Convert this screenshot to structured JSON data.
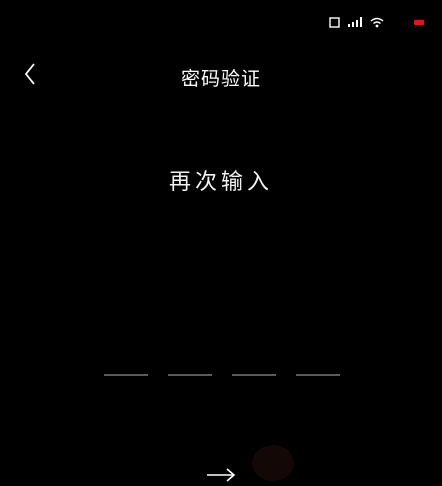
{
  "status_bar": {
    "icons": [
      "sim-icon",
      "signal-icon",
      "wifi-icon",
      "battery-icon"
    ],
    "battery_color": "#e0141e"
  },
  "header": {
    "back_icon": "chevron-left-icon",
    "title": "密码验证"
  },
  "main": {
    "prompt": "再次输入",
    "hint": "",
    "code_slots": 4,
    "next_icon": "arrow-right-icon"
  },
  "watermark": {
    "text": ""
  }
}
